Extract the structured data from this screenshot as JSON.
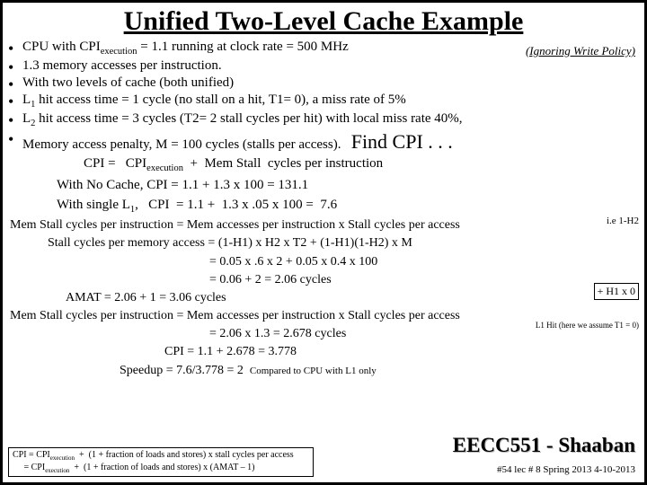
{
  "title": "Unified Two-Level Cache Example",
  "ignore": "(Ignoring Write Policy)",
  "b": [
    "CPU with CPI_execution = 1.1  running at clock rate = 500 MHz",
    "1.3 memory accesses per instruction.",
    "With two levels of cache (both unified)",
    "L1 hit access time = 1 cycle (no stall on a hit, T1= 0),  a miss rate of 5%",
    "L2 hit access time = 3 cycles (T2= 2 stall cycles per hit) with local miss rate 40%,",
    "Memory access penalty, M = 100 cycles (stalls per access)."
  ],
  "find": "Find CPI . . .",
  "m1": "CPI =   CPI_execution  +  Mem Stall  cycles per instruction",
  "m2": "With No Cache,   CPI  =  1.1 +  1.3 x 100  =  131.1",
  "m3": "With single L1,   CPI  = 1.1 +  1.3 x .05 x 100 =  7.6",
  "note1": "i.e 1-H2",
  "f1": "Mem Stall cycles per instruction =  Mem accesses per instruction  x  Stall cycles per access",
  "s1": "Stall cycles per memory access =   (1-H1) x H2 x T2    +  (1-H1)(1-H2) x M",
  "s2": "=  0.05 x  .6 x 2   +   0.05 x 0.4 x 100",
  "s3": "=   0.06 +   2   =   2.06  cycles",
  "note2": "+ H1 x 0",
  "amat": "AMAT = 2.06 + 1 = 3.06 cycles",
  "note3": "L1 Hit (here we assume T1 = 0)",
  "f2": "Mem Stall cycles per instruction =  Mem accesses per instruction  x  Stall cycles per access",
  "r1": "=    2.06  x  1.3  =    2.678  cycles",
  "r2": "CPI = 1.1 +  2.678 =  3.778",
  "r3": "Speedup  =  7.6/3.778 =   2",
  "comp": "Compared to CPU with L1 only",
  "box1": "CPI = CPI_execution  +  (1 + fraction of loads and stores) x stall cycles per access",
  "box2": "     = CPI_execution  +  (1 + fraction of loads and stores) x (AMAT – 1)",
  "course": "EECC551 - Shaaban",
  "foot": "#54  lec # 8   Spring 2013  4-10-2013"
}
